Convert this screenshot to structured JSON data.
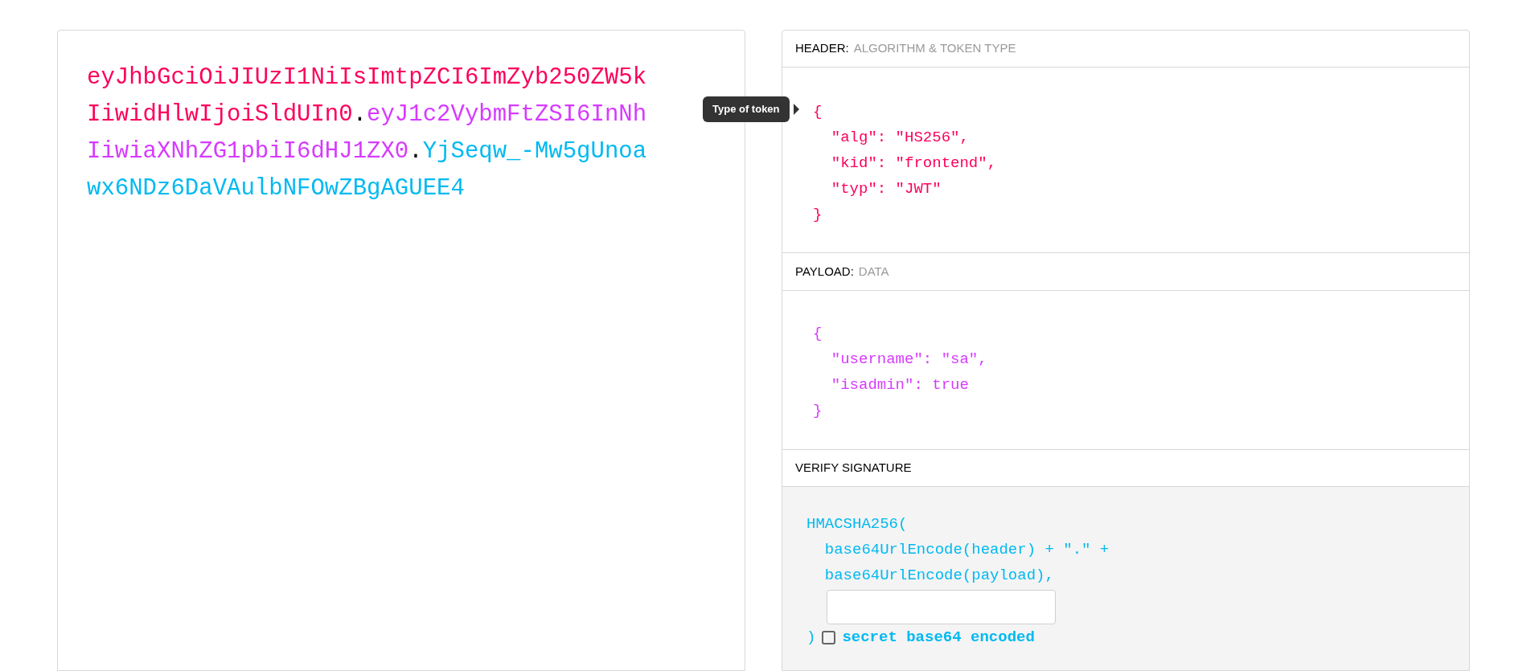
{
  "token": [
    {
      "text": "eyJhbGciOiJIUzI1NiIsImtpZCI6ImZyb250ZW5kIiwidHlwIjoiSldUIn0",
      "color": "#fb015b"
    },
    {
      "text": ".",
      "color": "#000000"
    },
    {
      "text": "eyJ1c2VybmFtZSI6InNhIiwiaXNhZG1pbiI6dHJ1ZX0",
      "color": "#d63aff"
    },
    {
      "text": ".",
      "color": "#000000"
    },
    {
      "text": "YjSeqw_-Mw5gUnoawx6NDz6DaVAulbNFOwZBgAGUEE4",
      "color": "#00b9f1"
    }
  ],
  "header": {
    "label": "HEADER:",
    "sublabel": "ALGORITHM & TOKEN TYPE",
    "color": "#fb015b",
    "tooltip": "Type of token",
    "lines": [
      "{",
      "  \"alg\": \"HS256\",",
      "  \"kid\": \"frontend\",",
      "  \"typ\": \"JWT\"",
      "}"
    ]
  },
  "payload": {
    "label": "PAYLOAD:",
    "sublabel": "DATA",
    "color": "#d63aff",
    "lines": [
      "{",
      "  \"username\": \"sa\",",
      "  \"isadmin\": true",
      "}"
    ]
  },
  "verify": {
    "label": "VERIFY SIGNATURE",
    "color": "#00b9f1",
    "lines": [
      "HMACSHA256(",
      "  base64UrlEncode(header) + \".\" +",
      "  base64UrlEncode(payload),"
    ],
    "close": ")",
    "checkbox": {
      "label": "secret base64 encoded",
      "checked": false
    }
  }
}
